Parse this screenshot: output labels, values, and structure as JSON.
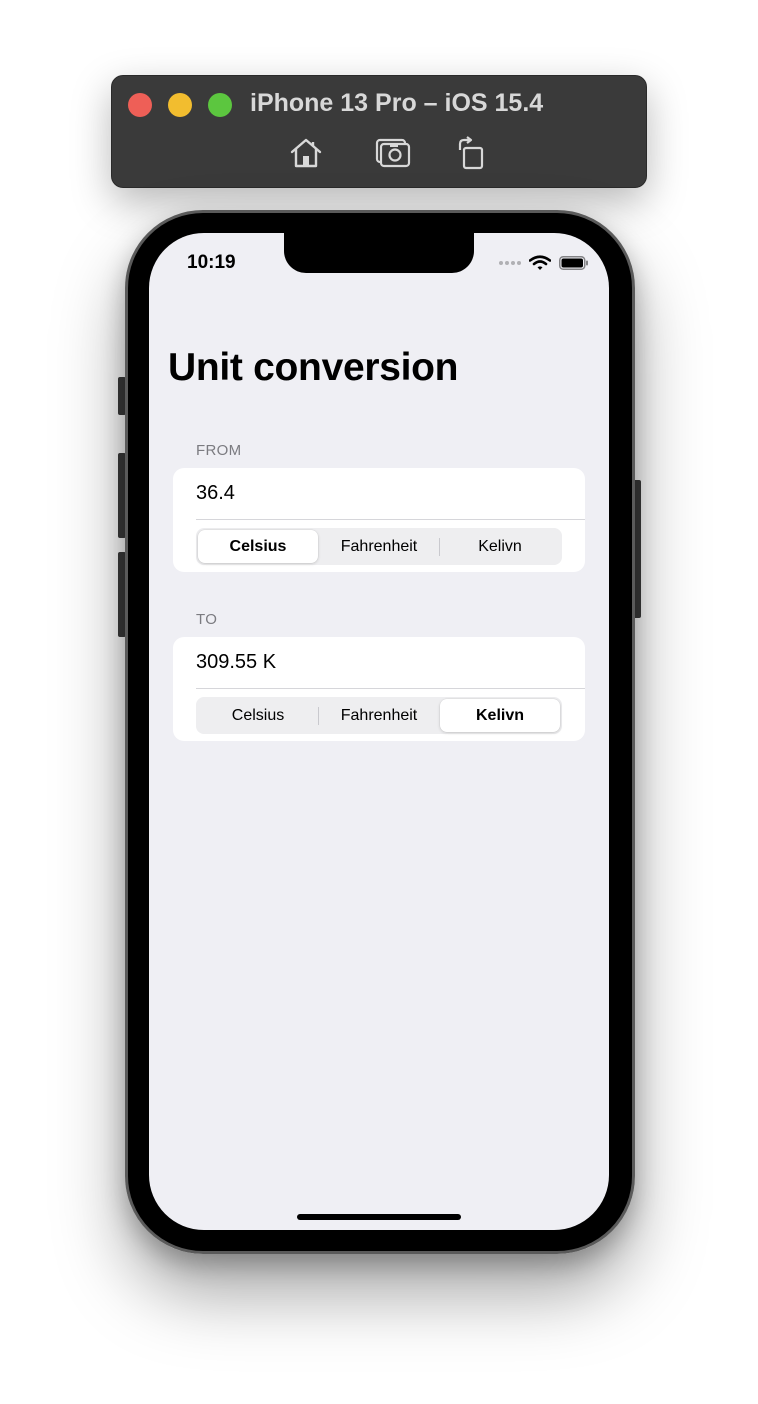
{
  "simulator": {
    "title": "iPhone 13 Pro – iOS 15.4",
    "toolbar": [
      "home-icon",
      "screenshot-icon",
      "rotate-icon"
    ]
  },
  "status_bar": {
    "time": "10:19"
  },
  "page": {
    "title": "Unit conversion"
  },
  "from_section": {
    "header": "FROM",
    "value": "36.4",
    "units": [
      "Celsius",
      "Fahrenheit",
      "Kelivn"
    ],
    "selected_unit": "Celsius"
  },
  "to_section": {
    "header": "TO",
    "value": "309.55 K",
    "units": [
      "Celsius",
      "Fahrenheit",
      "Kelivn"
    ],
    "selected_unit": "Kelivn"
  },
  "colors": {
    "background": "#efeff4",
    "card": "#ffffff",
    "segment_track": "#eeeef0",
    "section_header": "#7b7b80"
  }
}
